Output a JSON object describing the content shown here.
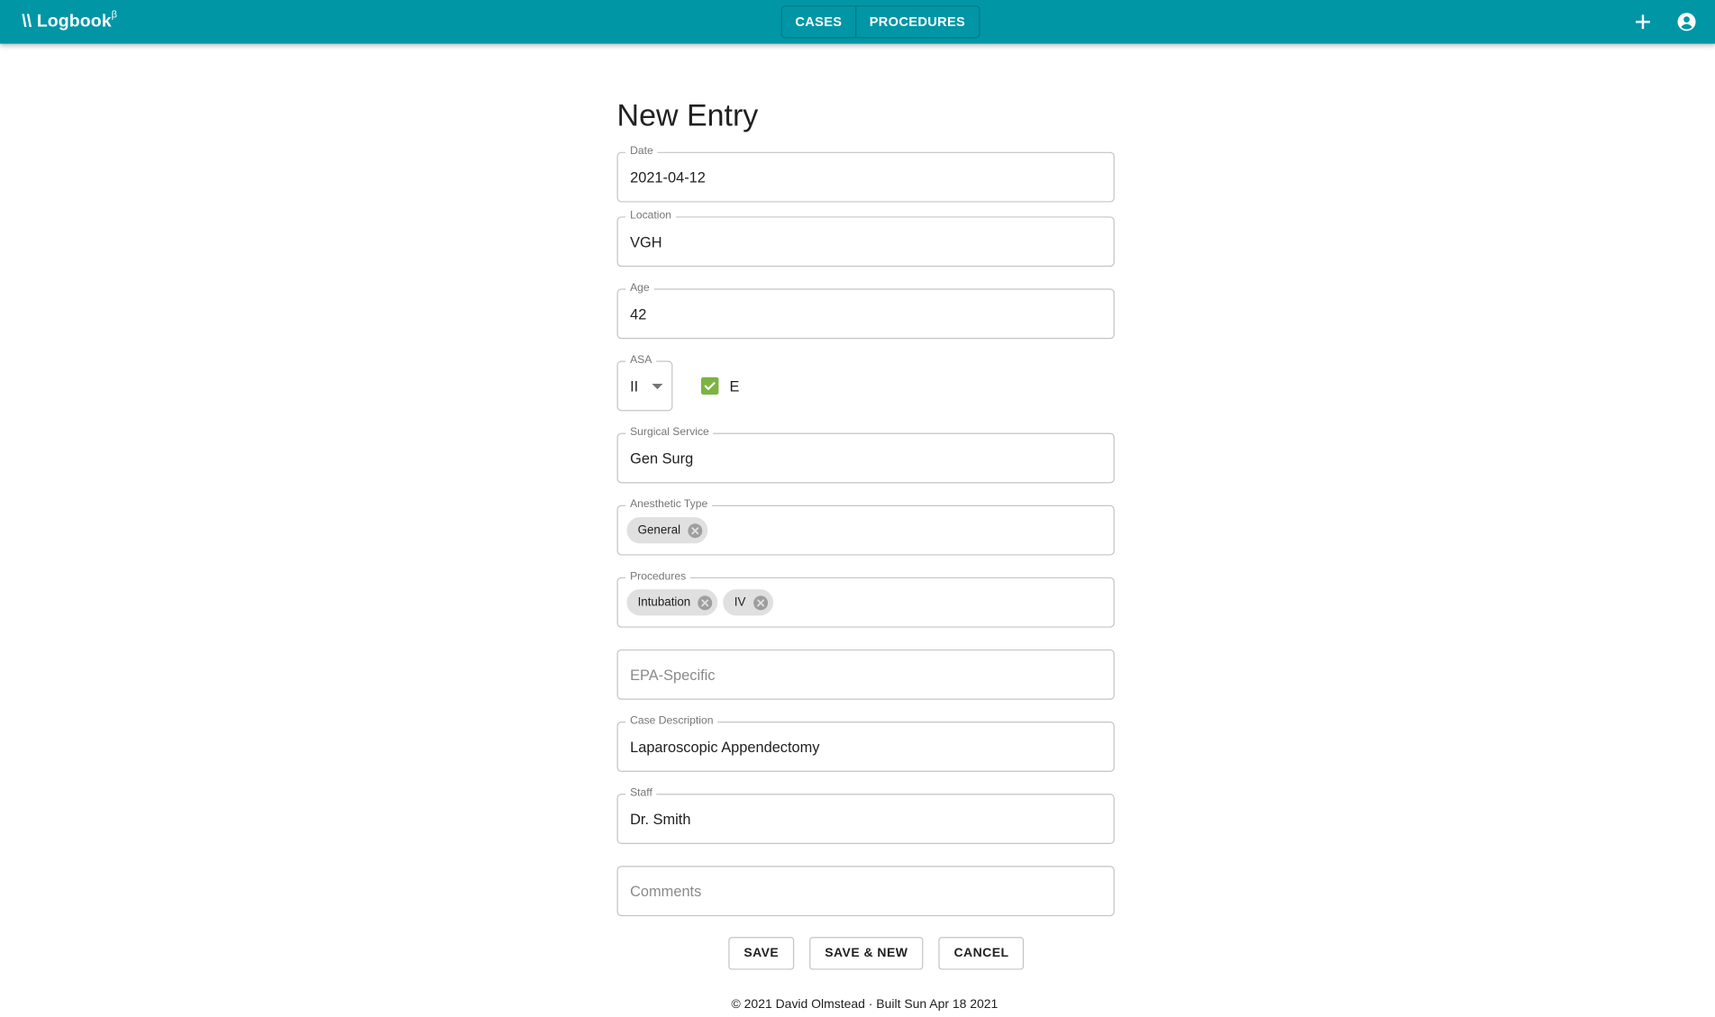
{
  "app": {
    "brand_prefix": "\\\\ Logbook",
    "brand_sup": "β",
    "bar_color": "#0096a6"
  },
  "nav": {
    "tabs": [
      {
        "label": "CASES"
      },
      {
        "label": "PROCEDURES"
      }
    ],
    "add_icon": "plus-icon",
    "account_icon": "account-circle-icon"
  },
  "form": {
    "title": "New Entry",
    "date": {
      "label": "Date",
      "value": "2021-04-12"
    },
    "location": {
      "label": "Location",
      "value": "VGH"
    },
    "age": {
      "label": "Age",
      "value": "42"
    },
    "asa": {
      "label": "ASA",
      "value": "II",
      "emergency_label": "E",
      "emergency_checked": true
    },
    "surgical_service": {
      "label": "Surgical Service",
      "value": "Gen Surg"
    },
    "anesthetic_type": {
      "label": "Anesthetic Type",
      "chips": [
        "General"
      ]
    },
    "procedures": {
      "label": "Procedures",
      "chips": [
        "Intubation",
        "IV"
      ]
    },
    "epa_specific": {
      "placeholder": "EPA-Specific"
    },
    "case_description": {
      "label": "Case Description",
      "value": "Laparoscopic Appendectomy"
    },
    "staff": {
      "label": "Staff",
      "value": "Dr. Smith"
    },
    "comments": {
      "placeholder": "Comments"
    }
  },
  "actions": {
    "save": "SAVE",
    "save_new": "SAVE & NEW",
    "cancel": "CANCEL"
  },
  "footer": {
    "text": "© 2021 David Olmstead · Built Sun Apr 18 2021"
  },
  "colors": {
    "accent": "#0096a6",
    "checkbox": "#7cb342",
    "chip": "#e0e0e0"
  }
}
